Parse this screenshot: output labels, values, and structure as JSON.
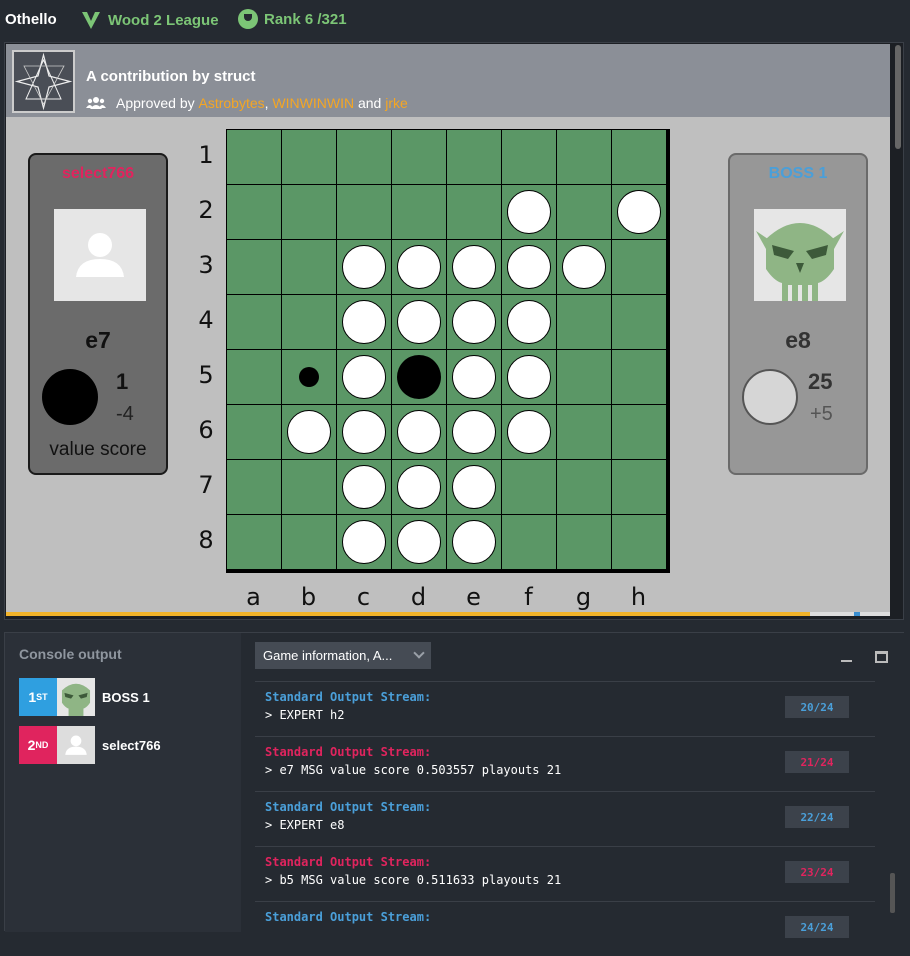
{
  "topbar": {
    "title": "Othello",
    "league": "Wood 2 League",
    "rank": "Rank 6 /321"
  },
  "contribution": {
    "heading": "A contribution by struct",
    "approved_prefix": "Approved by",
    "approvers": [
      "Astrobytes",
      "WINWINWIN",
      "jrke"
    ],
    "sep1": ",",
    "sep2": "and"
  },
  "players": {
    "left": {
      "name": "select766",
      "move": "e7",
      "count": "1",
      "delta": "-4",
      "label": "value score",
      "disc": "black"
    },
    "right": {
      "name": "BOSS 1",
      "move": "e8",
      "count": "25",
      "delta": "+5",
      "disc": "white"
    }
  },
  "board": {
    "columns": [
      "a",
      "b",
      "c",
      "d",
      "e",
      "f",
      "g",
      "h"
    ],
    "rows": [
      "1",
      "2",
      "3",
      "4",
      "5",
      "6",
      "7",
      "8"
    ],
    "grid": [
      "........",
      ".....W.W",
      "..WWWWW.",
      "..WWWW..",
      ".*WBWW..",
      ".WWWWW..",
      "..WWW...",
      "..WWW..."
    ]
  },
  "replay_progress": 0.91,
  "console": {
    "title": "Console output",
    "ranking": [
      {
        "place": "1",
        "suffix": "ST",
        "name": "BOSS 1",
        "color": "#2f9fe0"
      },
      {
        "place": "2",
        "suffix": "ND",
        "name": "select766",
        "color": "#e0245e"
      }
    ],
    "dropdown": "Game information, A...",
    "logs": [
      {
        "stream": "Standard Output Stream:",
        "line": "> EXPERT h2",
        "turn": "20/24",
        "color": "blue"
      },
      {
        "stream": "Standard Output Stream:",
        "line": "> e7 MSG value score 0.503557 playouts 21",
        "turn": "21/24",
        "color": "red"
      },
      {
        "stream": "Standard Output Stream:",
        "line": "> EXPERT e8",
        "turn": "22/24",
        "color": "blue"
      },
      {
        "stream": "Standard Output Stream:",
        "line": "> b5 MSG value score 0.511633 playouts 21",
        "turn": "23/24",
        "color": "red"
      },
      {
        "stream": "Standard Output Stream:",
        "line": "",
        "turn": "24/24",
        "color": "blue"
      }
    ]
  }
}
